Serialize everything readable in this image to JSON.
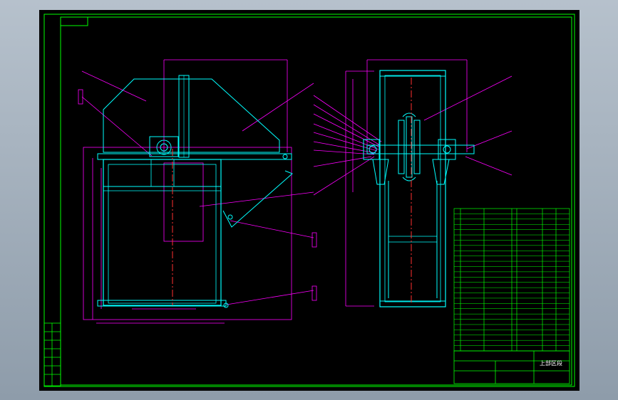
{
  "drawing": {
    "title_block_name": "上部区段"
  },
  "colors": {
    "viewport": "#000000",
    "border": "#00ff00",
    "outline": "#00ffff",
    "dimension": "#ff00ff",
    "centerline": "#ff3030",
    "table_text": "#ffffff"
  }
}
